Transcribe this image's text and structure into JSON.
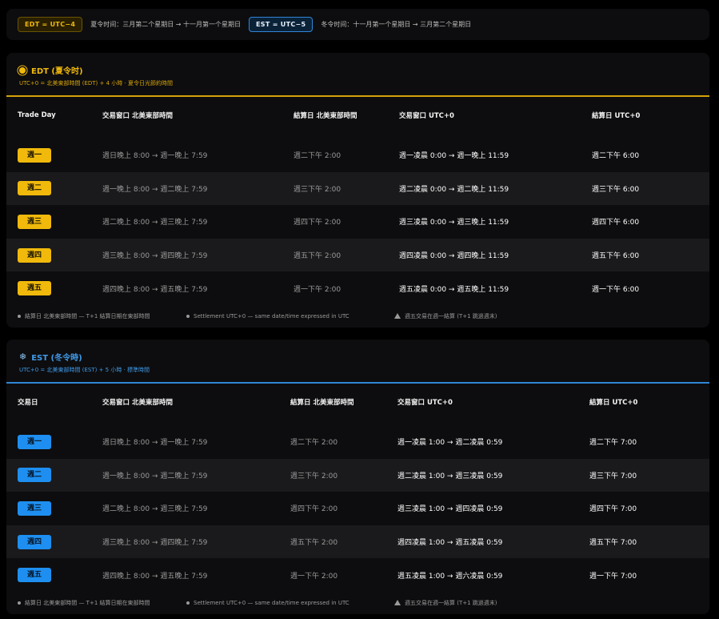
{
  "legend": {
    "edt_pill": "EDT = UTC−4",
    "edt_text": "夏令时间：三月第二个星期日 → 十一月第一个星期日",
    "est_pill": "EST = UTC−5",
    "est_text": "冬令时间：十一月第一个星期日 → 三月第二个星期日"
  },
  "edt": {
    "title": "EDT (夏令时)",
    "subtitle": "UTC+0 = 北美東部時間 (EDT) + 4 小時 · 夏令日光節約時間",
    "headers": [
      "Trade Day",
      "交易窗口 北美東部時間",
      "結算日 北美東部時間",
      "交易窗口 UTC+0",
      "結算日 UTC+0"
    ],
    "rows": [
      {
        "day": "週一",
        "window_et": "週日晚上 8:00 → 週一晚上 7:59",
        "settle_et": "週二下午 2:00",
        "window_utc": "週一凌晨 0:00 → 週一晚上 11:59",
        "settle_utc": "週二下午 6:00"
      },
      {
        "day": "週二",
        "window_et": "週一晚上 8:00 → 週二晚上 7:59",
        "settle_et": "週三下午 2:00",
        "window_utc": "週二凌晨 0:00 → 週二晚上 11:59",
        "settle_utc": "週三下午 6:00"
      },
      {
        "day": "週三",
        "window_et": "週二晚上 8:00 → 週三晚上 7:59",
        "settle_et": "週四下午 2:00",
        "window_utc": "週三凌晨 0:00 → 週三晚上 11:59",
        "settle_utc": "週四下午 6:00"
      },
      {
        "day": "週四",
        "window_et": "週三晚上 8:00 → 週四晚上 7:59",
        "settle_et": "週五下午 2:00",
        "window_utc": "週四凌晨 0:00 → 週四晚上 11:59",
        "settle_utc": "週五下午 6:00"
      },
      {
        "day": "週五",
        "window_et": "週四晚上 8:00 → 週五晚上 7:59",
        "settle_et": "週一下午 2:00",
        "window_utc": "週五凌晨 0:00 → 週五晚上 11:59",
        "settle_utc": "週一下午 6:00"
      }
    ],
    "foot": [
      "結算日 北美東部時間 — T+1 結算日期在東部時間",
      "Settlement UTC+0 — same date/time expressed in UTC",
      "週五交易在週一結算 (T+1 跳過週末)"
    ]
  },
  "est": {
    "title": "EST (冬令時)",
    "subtitle": "UTC+0 = 北美東部時間 (EST) + 5 小時 · 標準時間",
    "headers": [
      "交易日",
      "交易窗口 北美東部時間",
      "結算日 北美東部時間",
      "交易窗口 UTC+0",
      "結算日 UTC+0"
    ],
    "rows": [
      {
        "day": "週一",
        "window_et": "週日晚上 8:00 → 週一晚上 7:59",
        "settle_et": "週二下午 2:00",
        "window_utc": "週一凌晨 1:00 → 週二凌晨 0:59",
        "settle_utc": "週二下午 7:00"
      },
      {
        "day": "週二",
        "window_et": "週一晚上 8:00 → 週二晚上 7:59",
        "settle_et": "週三下午 2:00",
        "window_utc": "週二凌晨 1:00 → 週三凌晨 0:59",
        "settle_utc": "週三下午 7:00"
      },
      {
        "day": "週三",
        "window_et": "週二晚上 8:00 → 週三晚上 7:59",
        "settle_et": "週四下午 2:00",
        "window_utc": "週三凌晨 1:00 → 週四凌晨 0:59",
        "settle_utc": "週四下午 7:00"
      },
      {
        "day": "週四",
        "window_et": "週三晚上 8:00 → 週四晚上 7:59",
        "settle_et": "週五下午 2:00",
        "window_utc": "週四凌晨 1:00 → 週五凌晨 0:59",
        "settle_utc": "週五下午 7:00"
      },
      {
        "day": "週五",
        "window_et": "週四晚上 8:00 → 週五晚上 7:59",
        "settle_et": "週一下午 2:00",
        "window_utc": "週五凌晨 1:00 → 週六凌晨 0:59",
        "settle_utc": "週一下午 7:00"
      }
    ],
    "foot": [
      "結算日 北美東部時間 — T+1 結算日期在東部時間",
      "Settlement UTC+0 — same date/time expressed in UTC",
      "週五交易在週一結算 (T+1 跳過週末)"
    ]
  },
  "colors": {
    "edt_accent": "#f0b90b",
    "est_accent": "#1e8ff0",
    "background": "#000000",
    "card": "#0d0d0f"
  },
  "icons": {
    "edt": "sun-icon",
    "est": "snowflake-icon",
    "foot_bullet": "dot-icon",
    "foot_warning": "warning-icon"
  }
}
